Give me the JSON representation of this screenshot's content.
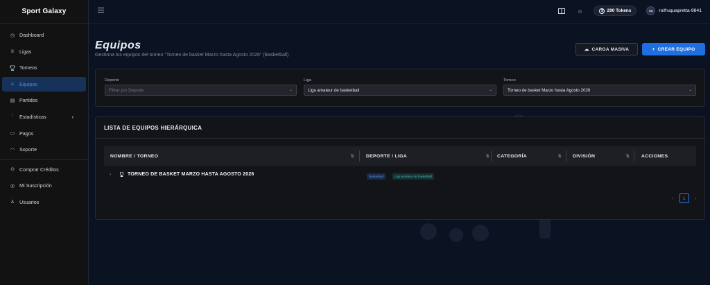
{
  "sidebar": {
    "brand": "Sport Galaxy",
    "items": [
      {
        "label": "Dashboard",
        "icon": "dashboard-icon",
        "glyph": "◷"
      },
      {
        "label": "Ligas",
        "icon": "trophy-cup-icon",
        "glyph": "♕"
      },
      {
        "label": "Torneos",
        "icon": "trophy-icon",
        "glyph": "🏆"
      },
      {
        "label": "Equipos",
        "icon": "team-icon",
        "glyph": "⚔",
        "active": true
      },
      {
        "label": "Partidos",
        "icon": "calendar-icon",
        "glyph": "▤"
      },
      {
        "label": "Estadísticas",
        "icon": "chart-icon",
        "glyph": "⫶",
        "has_children": true
      },
      {
        "label": "Pagos",
        "icon": "card-icon",
        "glyph": "▭"
      },
      {
        "label": "Soporte",
        "icon": "headset-icon",
        "glyph": "◠"
      },
      {
        "label": "Comprar Créditos",
        "icon": "credits-icon",
        "glyph": "⊙"
      },
      {
        "label": "Mi Suscripción",
        "icon": "subscription-icon",
        "glyph": "◎"
      },
      {
        "label": "Usuarios",
        "icon": "users-icon",
        "glyph": "♙"
      }
    ]
  },
  "topbar": {
    "tokens": "290 Tokens",
    "username": "roifruquapretta-9841",
    "avatar_text": "SG"
  },
  "page": {
    "title": "Equipos",
    "subtitle": "Gestiona los equipos del torneo \"Torneo de basket Marzo hasta Agosto 2026\" (Basketball)",
    "btn_carga": "CARGA MASIVA",
    "btn_crear": "CREAR EQUIPO"
  },
  "filters": {
    "deporte": {
      "label": "Deporte",
      "placeholder": "Filtrar por Deporte"
    },
    "liga": {
      "label": "Liga",
      "value": "Liga amateur de basketball"
    },
    "torneo": {
      "label": "Torneo",
      "value": "Torneo de basket Marzo hasta Agosto 2026"
    }
  },
  "list": {
    "title": "LISTA DE EQUIPOS HIERÁRQUICA",
    "columns": [
      "NOMBRE / TORNEO",
      "DEPORTE / LIGA",
      "CATEGORÍA",
      "DIVISIÓN",
      "ACCIONES"
    ],
    "rows": [
      {
        "name": "TORNEO DE BASKET MARZO HASTA AGOSTO 2026",
        "sport": "Basketball",
        "liga": "Liga amateur de basketball"
      }
    ],
    "page": "1"
  }
}
